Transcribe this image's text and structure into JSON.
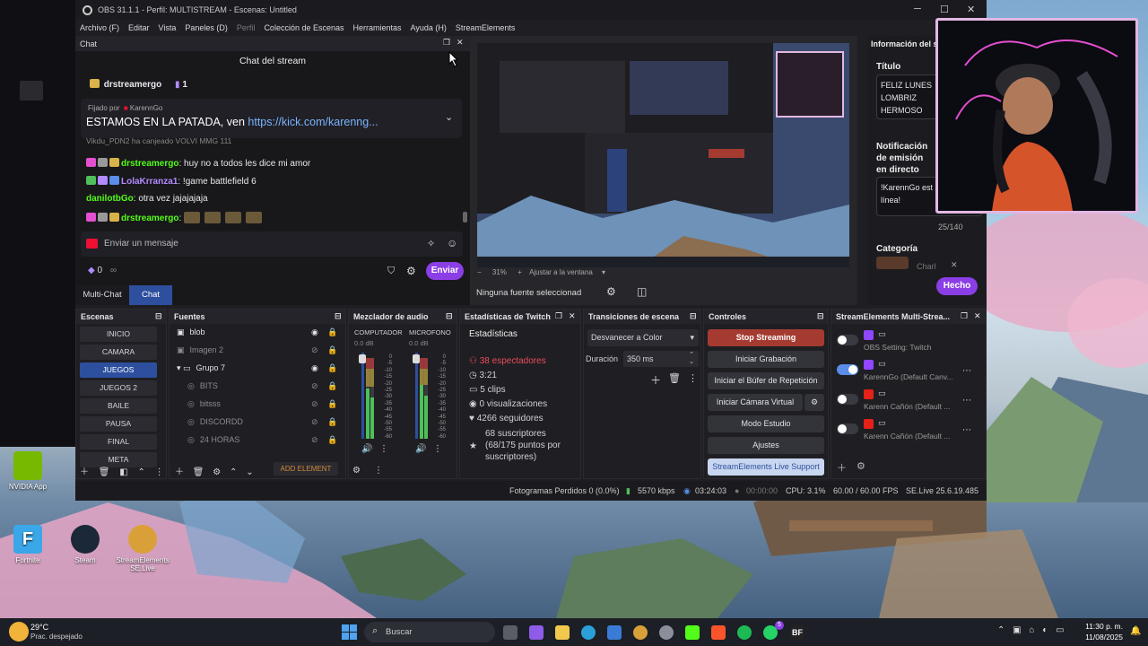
{
  "window_title": "OBS 31.1.1 - Perfil: MULTISTREAM - Escenas: Untitled",
  "menu": [
    {
      "label": "Archivo (F)",
      "dim": false
    },
    {
      "label": "Editar",
      "dim": false
    },
    {
      "label": "Vista",
      "dim": false
    },
    {
      "label": "Paneles (D)",
      "dim": false
    },
    {
      "label": "Perfil",
      "dim": true
    },
    {
      "label": "Colección de Escenas",
      "dim": false
    },
    {
      "label": "Herramientas",
      "dim": false
    },
    {
      "label": "Ayuda (H)",
      "dim": false
    },
    {
      "label": "StreamElements",
      "dim": false
    }
  ],
  "chat": {
    "dock_title": "Chat",
    "header": "Chat del stream",
    "top_user": "drstreamergo",
    "top_count": "1",
    "pinned_by": "Fijado por",
    "pinned_user": "KarennGo",
    "pinned_text": "ESTAMOS EN LA PATADA, ven",
    "pinned_link": "https://kick.com/karenng...",
    "partial_msg": "Vikdu_PDN2 ha canjeado VOLVI MMG",
    "partial_count": "111",
    "messages": [
      {
        "user": "drstreamergo",
        "text": ": huy no a todos les dice mi amor",
        "color": "#53fc18"
      },
      {
        "user": "LolaKrranza1",
        "text": ": !game battlefield 6",
        "color": "#b38bff"
      },
      {
        "user": "danilotbGo",
        "text": ": otra vez jajajajaja",
        "color": "#53fc18"
      },
      {
        "user": "drstreamergo",
        "text": ":",
        "color": "#53fc18"
      }
    ],
    "input_placeholder": "Enviar un mensaje",
    "points": "0",
    "infinity": "∞",
    "send_label": "Enviar",
    "tab_multichat": "Multi-Chat",
    "tab_chat": "Chat"
  },
  "preview": {
    "zoom": "31%",
    "fit_label": "Ajustar a la ventana",
    "no_source": "Ninguna fuente seleccionad"
  },
  "info_panel": {
    "title_header": "Información del s",
    "title_label": "Título",
    "title_lines": [
      "FELIZ LUNES",
      "LOMBRIZ",
      "HERMOSO"
    ],
    "notif_label_1": "Notificación",
    "notif_label_2": "de emisión",
    "notif_label_3": "en directo",
    "notif_text": [
      "!KarennGo est",
      "línea!"
    ],
    "counter": "25/140",
    "category_label": "Categoría",
    "category_value": "Charl",
    "done_label": "Hecho"
  },
  "scenes": {
    "title": "Escenas",
    "items": [
      "INICIO",
      "CAMARA",
      "JUEGOS",
      "JUEGOS 2",
      "BAILE",
      "PAUSA",
      "FINAL",
      "META"
    ],
    "selected_index": 2
  },
  "sources": {
    "title": "Fuentes",
    "items": [
      {
        "label": "blob",
        "indent": 0
      },
      {
        "label": "Imagen 2",
        "indent": 0
      },
      {
        "label": "Grupo 7",
        "indent": 1
      },
      {
        "label": "BITS",
        "indent": 2
      },
      {
        "label": "bitsss",
        "indent": 2
      },
      {
        "label": "DISCORDD",
        "indent": 2
      },
      {
        "label": "24 HORAS",
        "indent": 2
      }
    ],
    "add_element": "ADD ELEMENT"
  },
  "mixer": {
    "title": "Mezclador de audio",
    "ch1": "COMPUTADOR",
    "ch2": "MICROFONO",
    "ch1_db": "0.0 dB",
    "ch2_db": "0.0 dB",
    "scale": [
      "0",
      "-5",
      "-10",
      "-15",
      "-20",
      "-25",
      "-30",
      "-35",
      "-40",
      "-45",
      "-50",
      "-55",
      "-60"
    ]
  },
  "twitch_stats": {
    "title": "Estadísticas de Twitch",
    "tab": "Estadísticas",
    "viewers": "38 espectadores",
    "uptime": "3:21",
    "clips": "5 clips",
    "views": "0 visualizaciones",
    "followers": "4266 seguidores",
    "subs_1": "68 suscriptores",
    "subs_2": "(68/175 puntos por",
    "subs_3": "suscriptores)"
  },
  "transitions": {
    "title": "Transiciones de escena",
    "selected": "Desvanecer a Color",
    "duration_label": "Duración",
    "duration_value": "350 ms"
  },
  "controls": {
    "title": "Controles",
    "stop_streaming": "Stop Streaming",
    "start_recording": "Iniciar Grabación",
    "replay_buffer": "Iniciar el Búfer de Repetición",
    "virtual_cam": "Iniciar Cámara Virtual",
    "studio_mode": "Modo Estudio",
    "settings": "Ajustes",
    "live_support": "StreamElements Live Support"
  },
  "multistream": {
    "title": "StreamElements Multi-Strea...",
    "rows": [
      {
        "name": "OBS Setting: Twitch",
        "platform": "twitch",
        "on": false
      },
      {
        "name": "KarennGo (Default Canv...",
        "platform": "twitch",
        "on": true
      },
      {
        "name": "Karenn Cañón (Default ...",
        "platform": "youtube",
        "on": false
      },
      {
        "name": "Karenn Cañón (Default ...",
        "platform": "youtube",
        "on": false
      }
    ]
  },
  "status": {
    "dropped": "Fotogramas Perdidos 0 (0.0%)",
    "kbps": "5570 kbps",
    "live_time": "03:24:03",
    "rec_time": "00:00:00",
    "cpu": "CPU: 3.1%",
    "fps": "60.00 / 60.00 FPS",
    "version": "SE.Live 25.6.19.485"
  },
  "desktop": {
    "icons": [
      "NVIDIA App",
      "Fortnite",
      "Steam",
      "StreamElements SE.Live"
    ]
  },
  "taskbar": {
    "weather_temp": "29°C",
    "weather_desc": "Prac. despejado",
    "search": "Buscar",
    "time": "11:30 p. m.",
    "date": "11/08/2025",
    "notif_count": "5"
  }
}
